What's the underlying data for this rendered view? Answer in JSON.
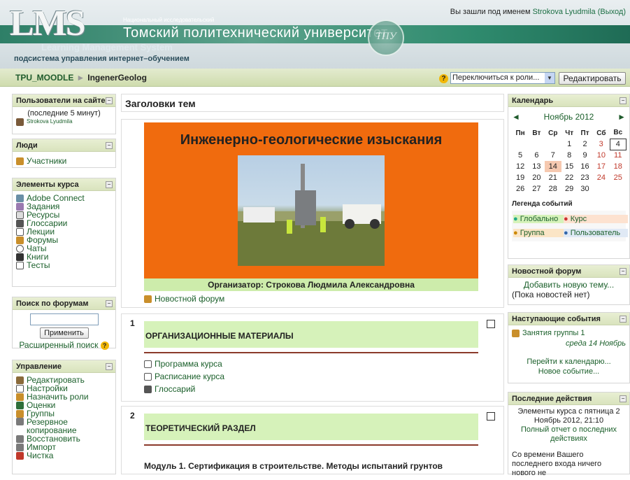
{
  "header": {
    "logo": "LMS",
    "logo_sub": "Learning Management System",
    "logo_sub2": "подсистема управления интернет–обучением",
    "univ_small": "Национальный исследовательский",
    "univ": "Томский политехнический университет",
    "seal_text": "ТПУ",
    "login_prefix": "Вы зашли под именем",
    "login_user": "Strokova Lyudmila",
    "login_logout": "(Выход)"
  },
  "navbar": {
    "crumb_home": "TPU_MOODLE",
    "crumb_sep": "►",
    "crumb_current": "IngenerGeolog",
    "role_select": "Переключиться к роли...",
    "edit_button": "Редактировать"
  },
  "left": {
    "users_online": {
      "title": "Пользователи на сайте",
      "note": "(последние 5 минут)",
      "user": "Strokova Lyudmila"
    },
    "people": {
      "title": "Люди",
      "items": [
        "Участники"
      ]
    },
    "activities": {
      "title": "Элементы курса",
      "items": [
        "Adobe Connect",
        "Задания",
        "Ресурсы",
        "Глоссарии",
        "Лекции",
        "Форумы",
        "Чаты",
        "Книги",
        "Тесты"
      ]
    },
    "search": {
      "title": "Поиск по форумам",
      "button": "Применить",
      "advanced": "Расширенный поиск"
    },
    "admin": {
      "title": "Управление",
      "items": [
        "Редактировать",
        "Настройки",
        "Назначить роли",
        "Оценки",
        "Группы",
        "Резервное копирование",
        "Восстановить",
        "Импорт",
        "Чистка"
      ]
    }
  },
  "center": {
    "title": "Заголовки тем",
    "banner_title": "Инженерно-геологические изыскания",
    "organizer": "Организатор: Строкова Людмила Александровна",
    "news_forum": "Новостной форум",
    "sections": [
      {
        "num": "1",
        "title": "ОРГАНИЗАЦИОННЫЕ МАТЕРИАЛЫ",
        "resources": [
          "Программа курса",
          "Расписание курса",
          "Глоссарий"
        ]
      },
      {
        "num": "2",
        "title": "ТЕОРЕТИЧЕСКИЙ РАЗДЕЛ",
        "module": "Модуль 1. Сертификация в строительстве. Методы испытаний грунтов"
      }
    ]
  },
  "right": {
    "calendar": {
      "title": "Календарь",
      "month": "Ноябрь 2012",
      "weekdays": [
        "Пн",
        "Вт",
        "Ср",
        "Чт",
        "Пт",
        "Сб",
        "Вс"
      ],
      "weeks": [
        [
          "",
          "",
          "",
          "1",
          "2",
          "3",
          "4"
        ],
        [
          "5",
          "6",
          "7",
          "8",
          "9",
          "10",
          "11"
        ],
        [
          "12",
          "13",
          "14",
          "15",
          "16",
          "17",
          "18"
        ],
        [
          "19",
          "20",
          "21",
          "22",
          "23",
          "24",
          "25"
        ],
        [
          "26",
          "27",
          "28",
          "29",
          "30",
          "",
          ""
        ]
      ],
      "legend_title": "Легенда событий",
      "legend": [
        "Глобально",
        "Курс",
        "Группа",
        "Пользователь"
      ]
    },
    "news": {
      "title": "Новостной форум",
      "add": "Добавить новую тему...",
      "none": "(Пока новостей нет)"
    },
    "upcoming": {
      "title": "Наступающие события",
      "event": "Занятия группы 1",
      "when": "среда 14 Ноябрь",
      "goto": "Перейти к календарю...",
      "new_event": "Новое событие..."
    },
    "recent": {
      "title": "Последние действия",
      "since": "Элементы курса с пятница 2 Ноябрь 2012, 21:10",
      "full_report": "Полный отчет о последних действиях",
      "nothing": "Со времени Вашего последнего входа ничего нового не"
    }
  },
  "colors": {
    "accent": "#1f5b2c",
    "banner": "#f06b0e",
    "section_head": "#d6f2ba",
    "block_head": "#d9e3bd"
  }
}
